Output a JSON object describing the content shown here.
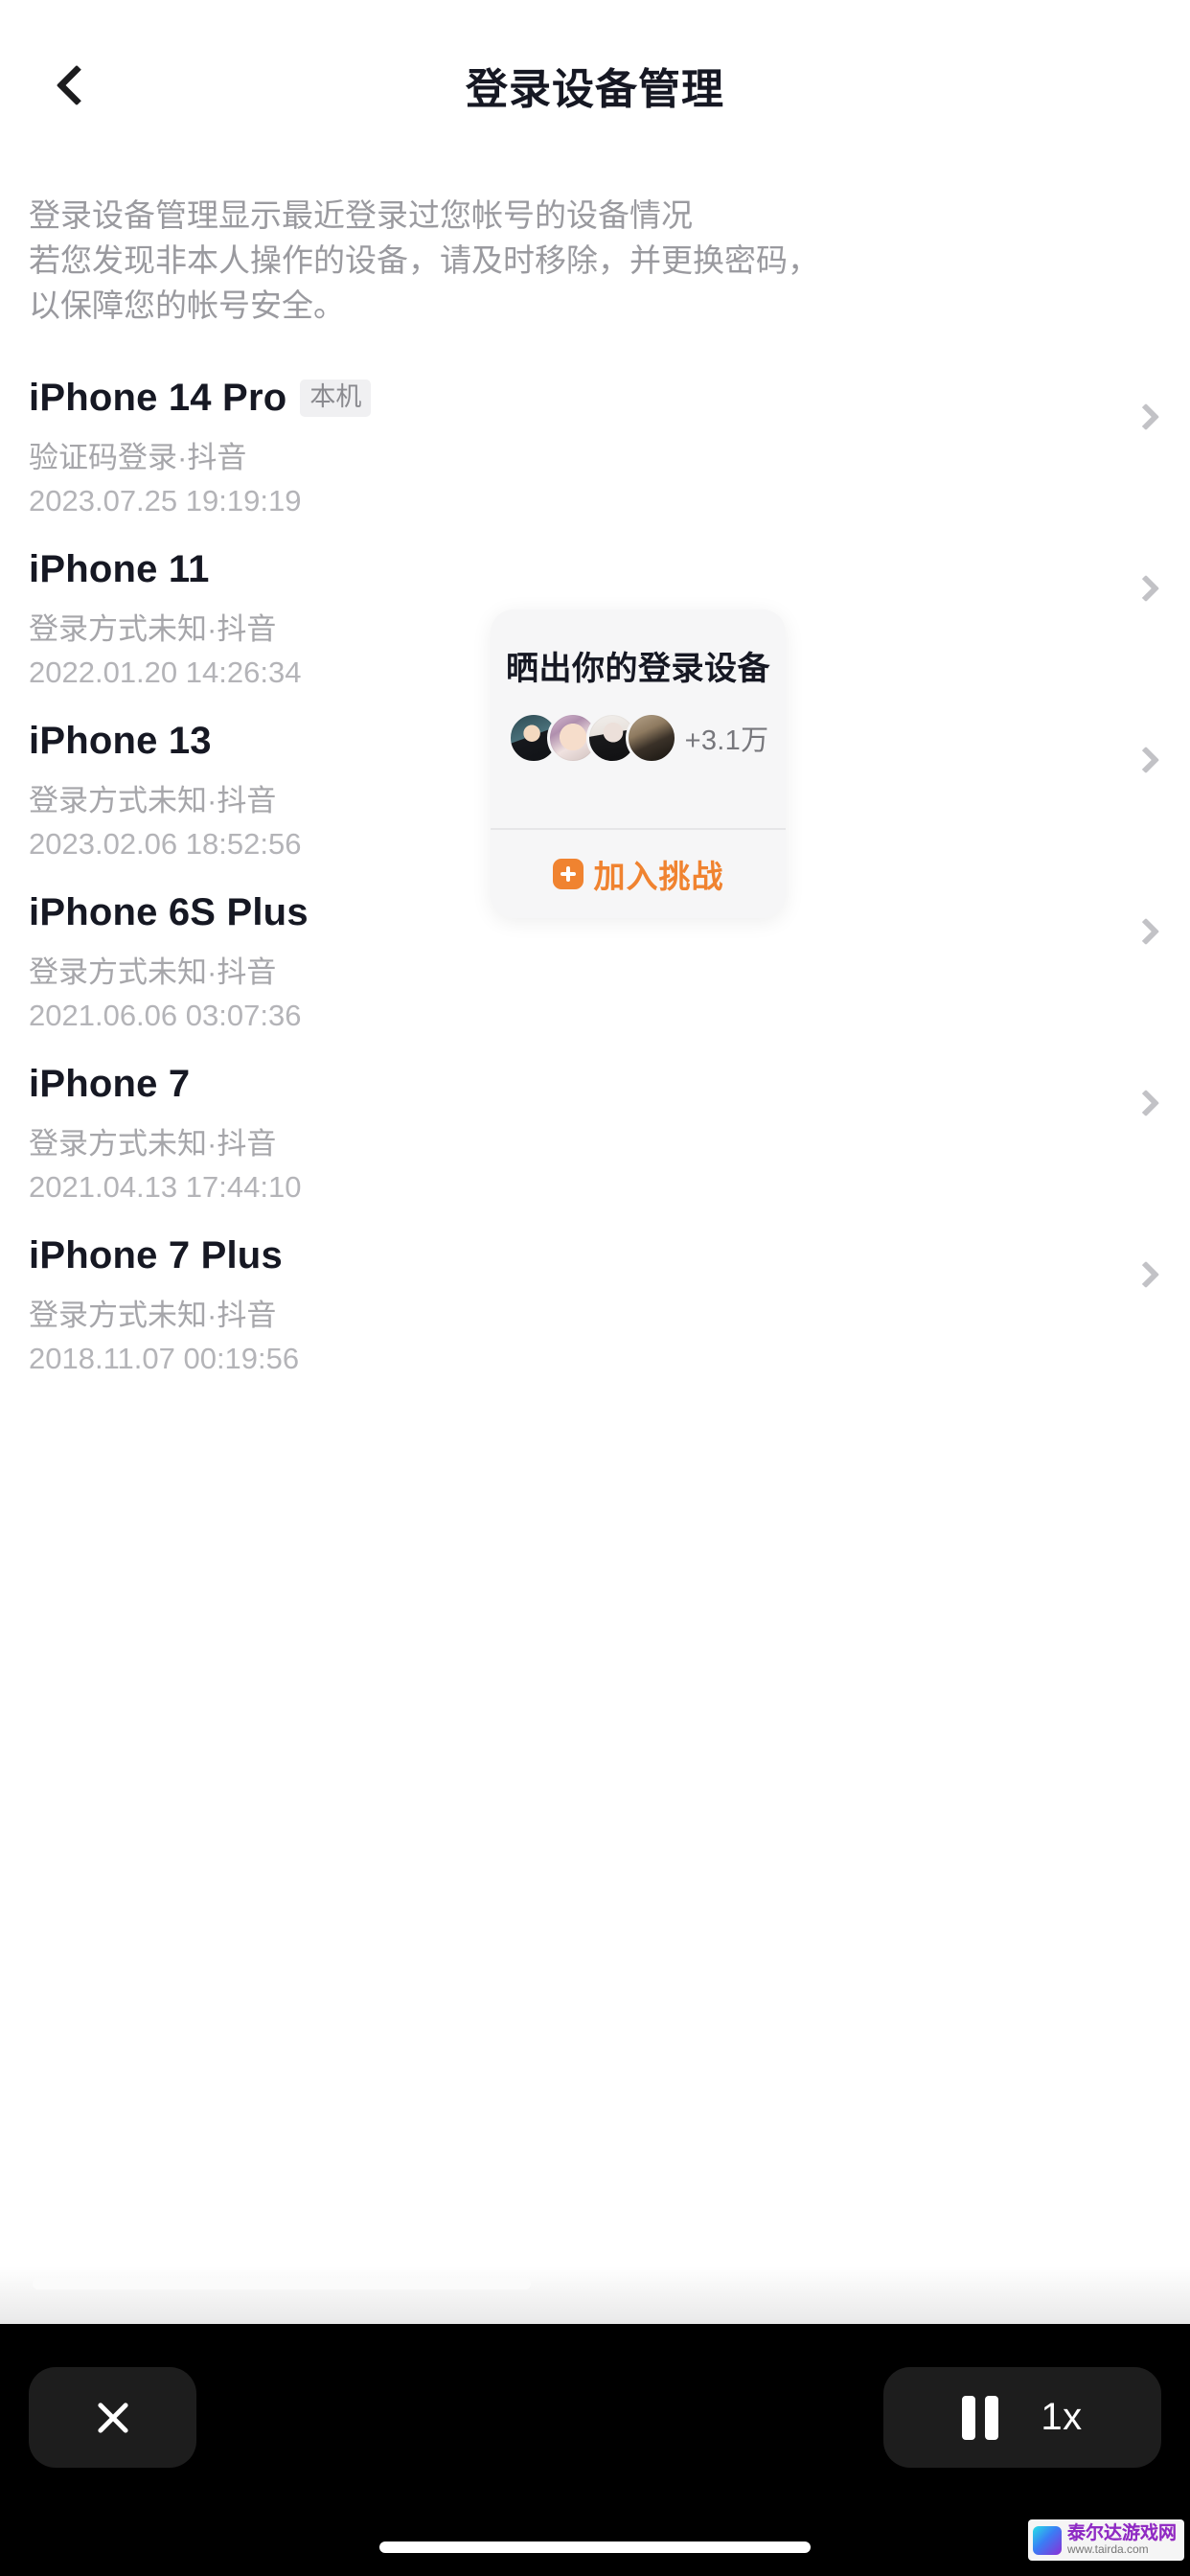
{
  "navbar": {
    "title": "登录设备管理",
    "back_icon": "chevron-left-icon"
  },
  "description": "登录设备管理显示最近登录过您帐号的设备情况\n若您发现非本人操作的设备，请及时移除，并更换密码，\n以保障您的帐号安全。",
  "devices": [
    {
      "name": "iPhone 14 Pro",
      "badge": "本机",
      "login_method": "验证码登录·抖音",
      "time": "2023.07.25 19:19:19"
    },
    {
      "name": "iPhone 11",
      "badge": "",
      "login_method": "登录方式未知·抖音",
      "time": "2022.01.20 14:26:34"
    },
    {
      "name": "iPhone 13",
      "badge": "",
      "login_method": "登录方式未知·抖音",
      "time": "2023.02.06 18:52:56"
    },
    {
      "name": "iPhone 6S Plus",
      "badge": "",
      "login_method": "登录方式未知·抖音",
      "time": "2021.06.06 03:07:36"
    },
    {
      "name": "iPhone 7",
      "badge": "",
      "login_method": "登录方式未知·抖音",
      "time": "2021.04.13 17:44:10"
    },
    {
      "name": "iPhone 7 Plus",
      "badge": "",
      "login_method": "登录方式未知·抖音",
      "time": "2018.11.07 00:19:56"
    }
  ],
  "challenge_card": {
    "title": "晒出你的登录设备",
    "participant_count": "+3.1万",
    "join_label": "加入挑战",
    "join_icon": "plus-badge-icon",
    "accent_color": "#f08330",
    "avatar_count": 4
  },
  "controls": {
    "close_icon": "close-icon",
    "pause_icon": "pause-icon",
    "speed_label": "1x"
  },
  "watermark": {
    "name": "泰尔达游戏网",
    "url": "www.tairda.com"
  }
}
